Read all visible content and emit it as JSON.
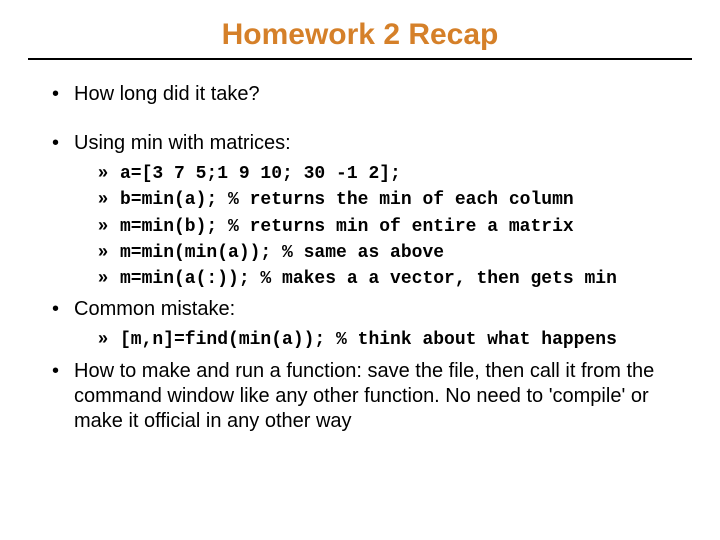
{
  "title": "Homework 2 Recap",
  "bullets": {
    "b1": "How long did it take?",
    "b2": "Using min with matrices:",
    "b2_code": {
      "l1": "a=[3 7 5;1 9 10; 30 -1 2];",
      "l2": "b=min(a); % returns the min of each column",
      "l3": "m=min(b); % returns min of entire a matrix",
      "l4": "m=min(min(a)); % same as above",
      "l5": "m=min(a(:)); % makes a a vector, then gets min"
    },
    "b3": "Common mistake:",
    "b3_code": {
      "l1": "[m,n]=find(min(a)); % think about what happens"
    },
    "b4": "How to make and run a function: save the file, then call it from the command window like any other function. No need to 'compile' or make it official in any other way"
  }
}
